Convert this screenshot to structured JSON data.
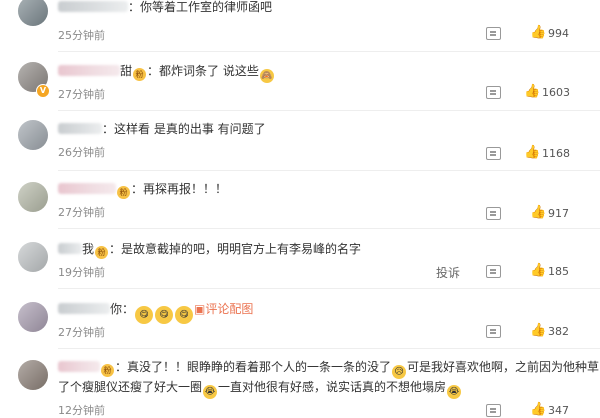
{
  "comments": [
    {
      "user_visible": "ua自棠小号",
      "text": "你等着工作室的律师函吧",
      "time": "25分钟前",
      "likes": "994"
    },
    {
      "user_visible": "言甜",
      "text": "都炸词条了 说这些",
      "time": "27分钟前",
      "likes": "1603"
    },
    {
      "user_visible": "",
      "text": "这样看 是真的出事 有问题了",
      "time": "26分钟前",
      "likes": "1168"
    },
    {
      "user_visible": "",
      "text": "再探再报！！！",
      "time": "27分钟前",
      "likes": "917"
    },
    {
      "user_visible": "我",
      "text": "是故意截掉的吧，明明官方上有李易峰的名字",
      "time": "19分钟前",
      "likes": "185",
      "report": "投诉"
    },
    {
      "user_visible": "你",
      "text": "",
      "link": "评论配图",
      "time": "27分钟前",
      "likes": "382"
    },
    {
      "user_visible": "",
      "text_part1": "真没了！！眼睁睁的看着那个人的一条一条的没了",
      "text_part2": "可是我好喜欢他啊，之前因为他种草",
      "text_line2_part1": "了个瘦腿仪还瘦了好大一圈",
      "text_line2_part2": "一直对他很有好感，说实话真的不想他塌房",
      "time": "12分钟前",
      "likes": "347"
    }
  ],
  "icons": {
    "comment": "comment-icon",
    "like": "thumbs-up-icon"
  }
}
